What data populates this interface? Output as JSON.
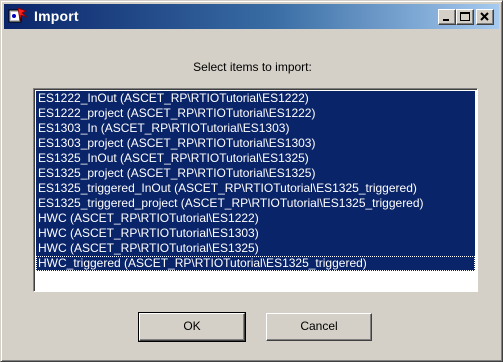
{
  "window": {
    "title": "Import",
    "icon": "import-app-icon",
    "controls": {
      "minimize": "minimize-icon",
      "maximize": "maximize-icon",
      "close": "close-icon"
    }
  },
  "dialog": {
    "prompt": "Select items to import:",
    "items": [
      "ES1222_InOut (ASCET_RP\\RTIOTutorial\\ES1222)",
      "ES1222_project (ASCET_RP\\RTIOTutorial\\ES1222)",
      "ES1303_In (ASCET_RP\\RTIOTutorial\\ES1303)",
      "ES1303_project (ASCET_RP\\RTIOTutorial\\ES1303)",
      "ES1325_InOut (ASCET_RP\\RTIOTutorial\\ES1325)",
      "ES1325_project (ASCET_RP\\RTIOTutorial\\ES1325)",
      "ES1325_triggered_InOut (ASCET_RP\\RTIOTutorial\\ES1325_triggered)",
      "ES1325_triggered_project (ASCET_RP\\RTIOTutorial\\ES1325_triggered)",
      "HWC (ASCET_RP\\RTIOTutorial\\ES1222)",
      "HWC (ASCET_RP\\RTIOTutorial\\ES1303)",
      "HWC (ASCET_RP\\RTIOTutorial\\ES1325)",
      "HWC_triggered (ASCET_RP\\RTIOTutorial\\ES1325_triggered)"
    ],
    "ok_label": "OK",
    "cancel_label": "Cancel"
  },
  "colors": {
    "selection": "#0a246a",
    "face": "#d4d0c8",
    "title_start": "#0a246a",
    "title_end": "#a6caf0"
  }
}
